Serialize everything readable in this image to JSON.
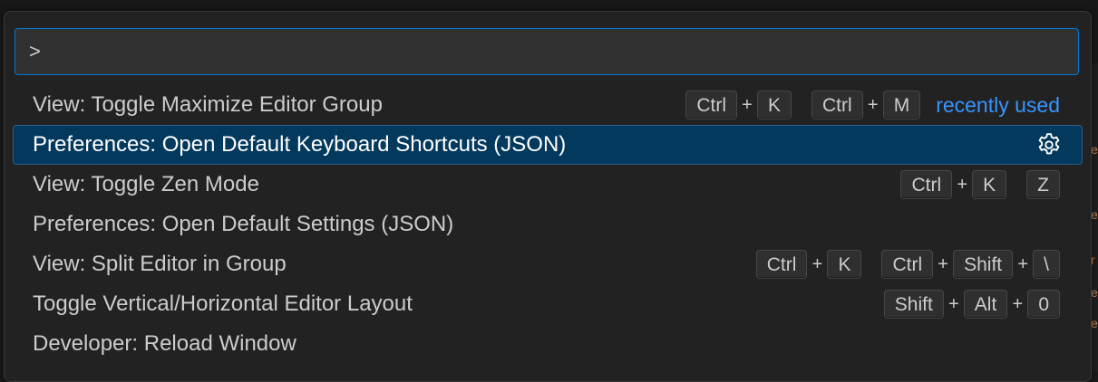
{
  "input": {
    "value": ">"
  },
  "commands": [
    {
      "label": "View: Toggle Maximize Editor Group",
      "keys": [
        [
          "Ctrl",
          "K"
        ],
        [
          "Ctrl",
          "M"
        ]
      ],
      "tag": "recently used"
    },
    {
      "label": "Preferences: Open Default Keyboard Shortcuts (JSON)",
      "selected": true,
      "icon": "gear-icon"
    },
    {
      "label": "View: Toggle Zen Mode",
      "keys": [
        [
          "Ctrl",
          "K"
        ],
        [
          "Z"
        ]
      ]
    },
    {
      "label": "Preferences: Open Default Settings (JSON)"
    },
    {
      "label": "View: Split Editor in Group",
      "keys": [
        [
          "Ctrl",
          "K"
        ],
        [
          "Ctrl",
          "Shift",
          "\\"
        ]
      ]
    },
    {
      "label": "Toggle Vertical/Horizontal Editor Layout",
      "keys": [
        [
          "Shift",
          "Alt",
          "0"
        ]
      ]
    },
    {
      "label": "Developer: Reload Window"
    }
  ],
  "colors": {
    "accent": "#0078d4",
    "selection": "#04395e",
    "link": "#3794ff"
  }
}
